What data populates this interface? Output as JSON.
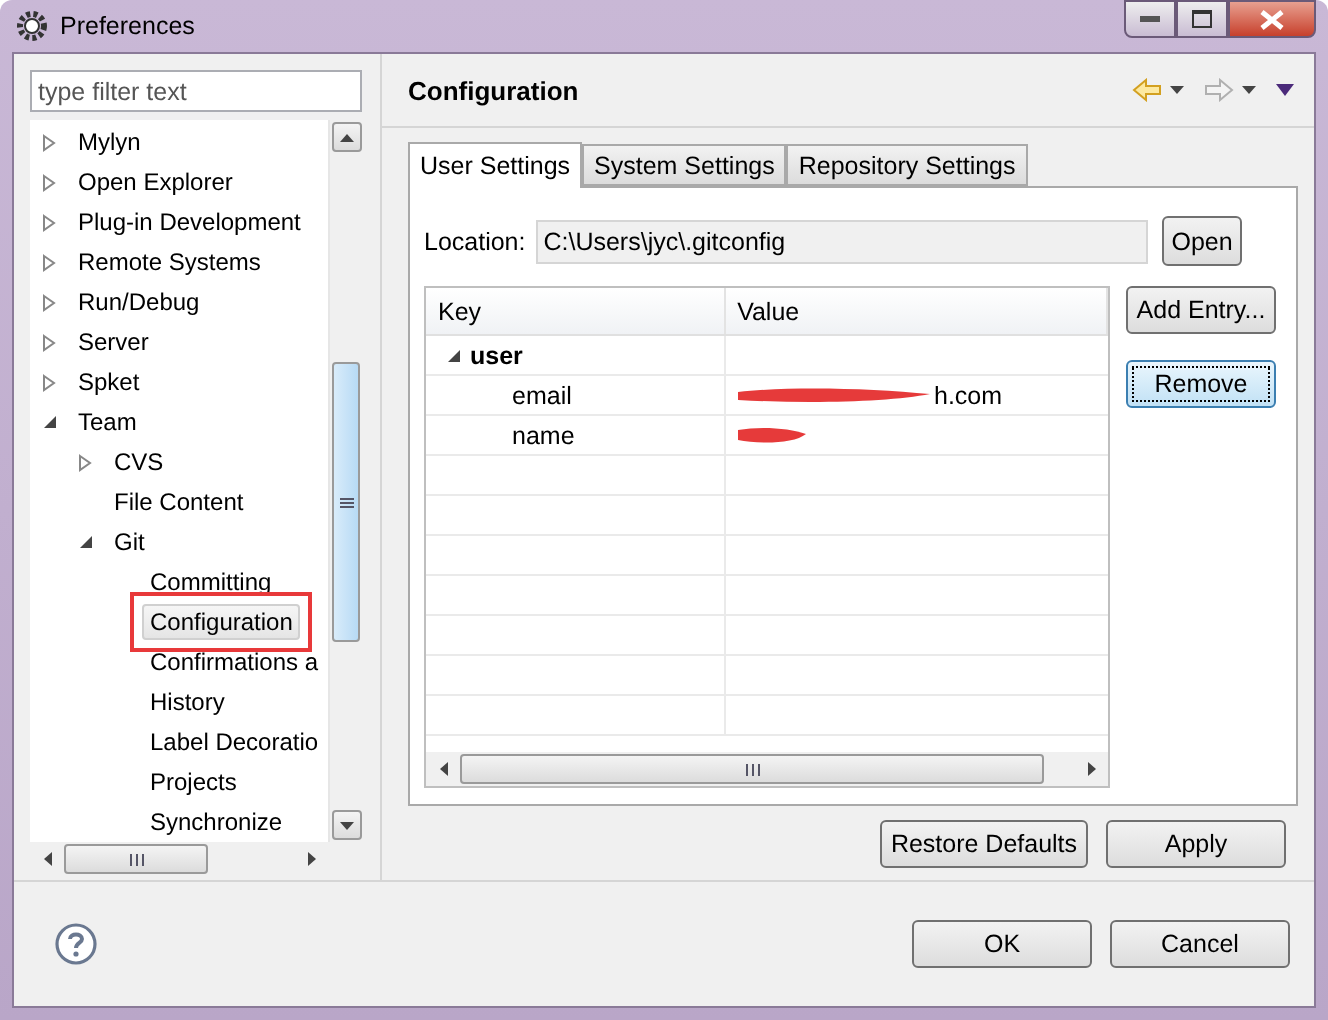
{
  "window": {
    "title": "Preferences"
  },
  "filter": {
    "placeholder": "type filter text"
  },
  "tree": [
    {
      "label": "Mylyn",
      "expanded": false,
      "selected": false
    },
    {
      "label": "Open Explorer",
      "expanded": false,
      "selected": false
    },
    {
      "label": "Plug-in Development",
      "expanded": false,
      "selected": false
    },
    {
      "label": "Remote Systems",
      "expanded": false,
      "selected": false
    },
    {
      "label": "Run/Debug",
      "expanded": false,
      "selected": false
    },
    {
      "label": "Server",
      "expanded": false,
      "selected": false
    },
    {
      "label": "Spket",
      "expanded": false,
      "selected": false
    },
    {
      "label": "Team",
      "expanded": true,
      "selected": false,
      "children": [
        {
          "label": "CVS",
          "expanded": false,
          "selected": false
        },
        {
          "label": "File Content",
          "selected": false
        },
        {
          "label": "Git",
          "expanded": true,
          "selected": false,
          "children": [
            {
              "label": "Committing",
              "selected": false
            },
            {
              "label": "Configuration",
              "selected": true,
              "highlighted": true
            },
            {
              "label": "Confirmations a",
              "selected": false
            },
            {
              "label": "History",
              "selected": false
            },
            {
              "label": "Label Decoratio",
              "selected": false
            },
            {
              "label": "Projects",
              "selected": false
            },
            {
              "label": "Synchronize",
              "selected": false
            }
          ]
        }
      ]
    }
  ],
  "page": {
    "title": "Configuration"
  },
  "tabs": [
    {
      "label": "User Settings",
      "selected": true
    },
    {
      "label": "System Settings",
      "selected": false
    },
    {
      "label": "Repository Settings",
      "selected": false
    }
  ],
  "location": {
    "label": "Location:",
    "value": "C:\\Users\\jyc\\.gitconfig",
    "button": "Open"
  },
  "table": {
    "columns": [
      "Key",
      "Value"
    ],
    "rows": [
      {
        "key": "user",
        "expanded": true,
        "children": [
          {
            "key": "email",
            "value": "h.com",
            "redacted": true
          },
          {
            "key": "name",
            "redacted": true
          }
        ]
      }
    ]
  },
  "side_buttons": [
    {
      "label": "Add Entry...",
      "focused": false
    },
    {
      "label": "Remove",
      "focused": true
    }
  ],
  "page_buttons": [
    "Restore Defaults",
    "Apply"
  ],
  "dialog_buttons": [
    "OK",
    "Cancel"
  ]
}
